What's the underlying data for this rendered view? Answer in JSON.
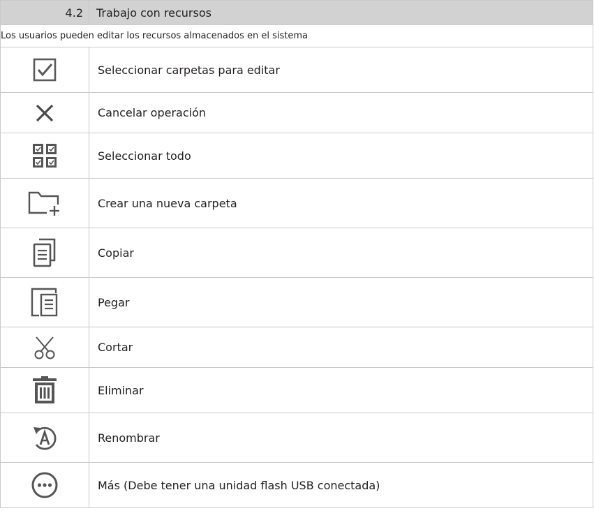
{
  "section": {
    "number": "4.2",
    "title": "Trabajo con recursos"
  },
  "intro": "Los usuarios pueden editar los recursos almacenados en el sistema",
  "items": [
    {
      "icon": "checkbox-icon",
      "label": "Seleccionar carpetas para editar"
    },
    {
      "icon": "close-icon",
      "label": "Cancelar operación"
    },
    {
      "icon": "select-all-icon",
      "label": "Seleccionar todo"
    },
    {
      "icon": "new-folder-icon",
      "label": "Crear una nueva carpeta"
    },
    {
      "icon": "copy-icon",
      "label": "Copiar"
    },
    {
      "icon": "paste-icon",
      "label": "Pegar"
    },
    {
      "icon": "scissors-icon",
      "label": "Cortar"
    },
    {
      "icon": "trash-icon",
      "label": "Eliminar"
    },
    {
      "icon": "rename-icon",
      "label": "Renombrar"
    },
    {
      "icon": "more-icon",
      "label": "Más (Debe tener una unidad flash USB conectada)"
    }
  ]
}
